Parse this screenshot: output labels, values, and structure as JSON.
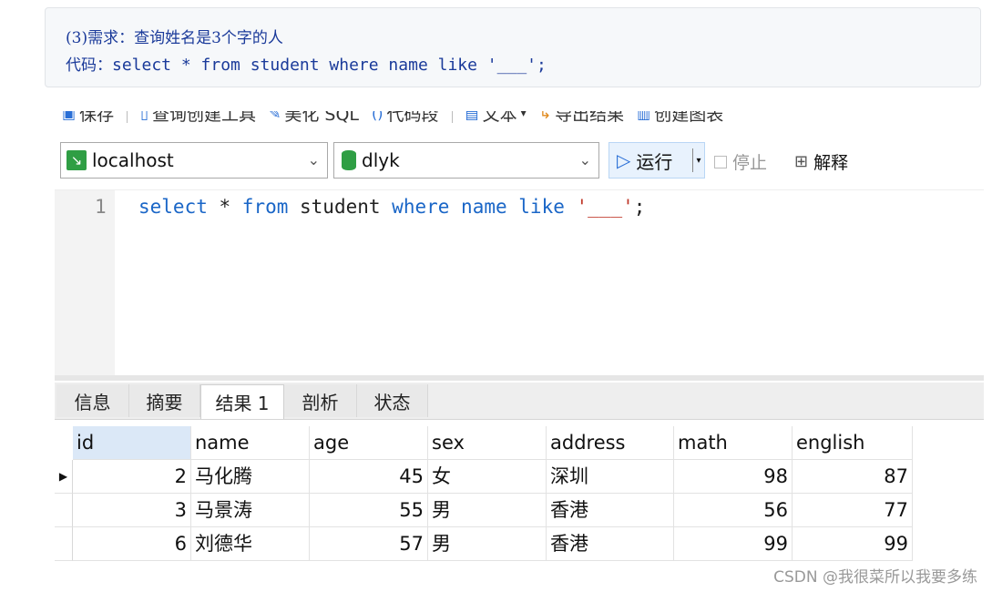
{
  "note": {
    "requirement": "(3)需求：查询姓名是3个字的人",
    "code_label": "代码：",
    "code": "select * from student where name like '___';"
  },
  "toolbar": {
    "save": "保存",
    "query_builder": "查询创建工具",
    "beautify": "美化 SQL",
    "snippet": "代码段",
    "text": "文本",
    "export": "导出结果",
    "chart": "创建图表"
  },
  "connection": {
    "server": "localhost",
    "database": "dlyk",
    "run": "运行",
    "stop": "停止",
    "explain": "解释"
  },
  "editor": {
    "line_number": "1",
    "tokens": [
      {
        "t": "select",
        "c": "kw"
      },
      {
        "t": " * ",
        "c": ""
      },
      {
        "t": "from",
        "c": "kw"
      },
      {
        "t": " student ",
        "c": ""
      },
      {
        "t": "where",
        "c": "kw"
      },
      {
        "t": " ",
        "c": ""
      },
      {
        "t": "name",
        "c": "kw"
      },
      {
        "t": " ",
        "c": ""
      },
      {
        "t": "like",
        "c": "kw"
      },
      {
        "t": " ",
        "c": ""
      },
      {
        "t": "'___'",
        "c": "str"
      },
      {
        "t": ";",
        "c": ""
      }
    ]
  },
  "tabs": [
    "信息",
    "摘要",
    "结果 1",
    "剖析",
    "状态"
  ],
  "active_tab": "结果 1",
  "results": {
    "columns": [
      "id",
      "name",
      "age",
      "sex",
      "address",
      "math",
      "english"
    ],
    "rows": [
      [
        "2",
        "马化腾",
        "45",
        "女",
        "深圳",
        "98",
        "87"
      ],
      [
        "3",
        "马景涛",
        "55",
        "男",
        "香港",
        "56",
        "77"
      ],
      [
        "6",
        "刘德华",
        "57",
        "男",
        "香港",
        "99",
        "99"
      ]
    ]
  },
  "watermark": "CSDN @我很菜所以我要多练"
}
